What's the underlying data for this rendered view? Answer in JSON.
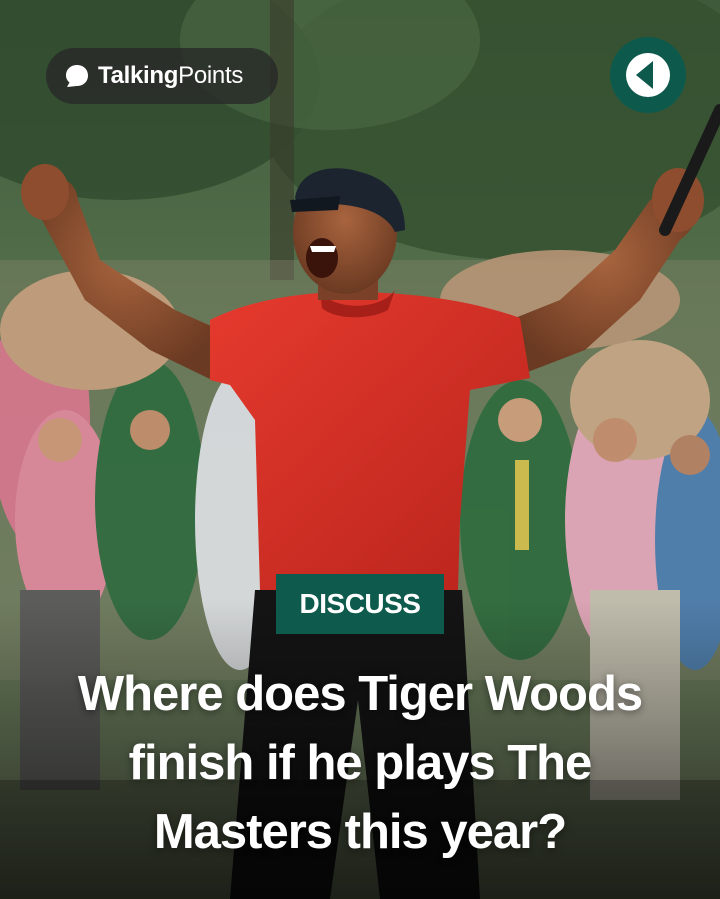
{
  "brand": {
    "name_part1": "Talking",
    "name_part2": "Points",
    "logo_icon": "talking-points-logo",
    "badge_icon": "play-triangle-icon",
    "accent_color": "#0e5a4c"
  },
  "tag": {
    "label": "DISCUSS"
  },
  "headline": {
    "line1": "Where does Tiger Woods",
    "line2": "finish if he plays The",
    "line3": "Masters this year?"
  }
}
